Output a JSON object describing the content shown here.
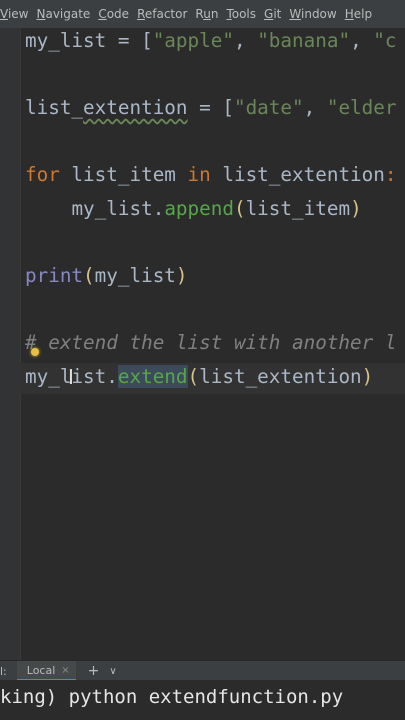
{
  "menu": {
    "items": [
      {
        "prefix": "",
        "mnemonic": "V",
        "rest": "iew"
      },
      {
        "prefix": "",
        "mnemonic": "N",
        "rest": "avigate"
      },
      {
        "prefix": "",
        "mnemonic": "C",
        "rest": "ode"
      },
      {
        "prefix": "",
        "mnemonic": "R",
        "rest": "efactor"
      },
      {
        "prefix": "R",
        "mnemonic": "u",
        "rest": "n"
      },
      {
        "prefix": "",
        "mnemonic": "T",
        "rest": "ools"
      },
      {
        "prefix": "",
        "mnemonic": "G",
        "rest": "it"
      },
      {
        "prefix": "",
        "mnemonic": "W",
        "rest": "indow"
      },
      {
        "prefix": "",
        "mnemonic": "H",
        "rest": "elp"
      }
    ]
  },
  "editor": {
    "line1": {
      "a": "my_list = [",
      "s1": "\"apple\"",
      "b": ", ",
      "s2": "\"banana\"",
      "c": ", ",
      "s3": "\"c"
    },
    "line2": {
      "a": "list_",
      "typo": "extention",
      "b": " = [",
      "s1": "\"date\"",
      "c": ", ",
      "s2": "\"elder"
    },
    "line3": {
      "kw1": "for",
      "a": " list_item ",
      "kw2": "in",
      "b": " list_extention",
      "c": ":"
    },
    "line4": {
      "indent": "    ",
      "a": "my_list.",
      "call": "append",
      "p1": "(",
      "b": "list_item",
      "p2": ")"
    },
    "line5": {
      "fn": "print",
      "p1": "(",
      "a": "my_list",
      "p2": ")"
    },
    "line6": {
      "comment": "# extend the list with another l"
    },
    "line7": {
      "a": "my_list.",
      "call": "extend",
      "p1": "(",
      "b": "list_extention",
      "p2": ")"
    },
    "cursor_glyph": "I"
  },
  "terminal": {
    "tab_prefix": "l:",
    "tab_label": "Local",
    "close_glyph": "×",
    "add_glyph": "+",
    "more_glyph": "∨",
    "command_line": "king) python extendfunction.py"
  },
  "colors": {
    "background": "#2b2b2b",
    "keyword": "#cc7832",
    "string": "#6a8759",
    "builtin": "#8888c6",
    "method_call": "#57a64a",
    "comment": "#808080",
    "default_text": "#a9b7c6"
  },
  "icons": {
    "bulb": "intention-bulb-icon",
    "cursor": "text-cursor-icon"
  }
}
